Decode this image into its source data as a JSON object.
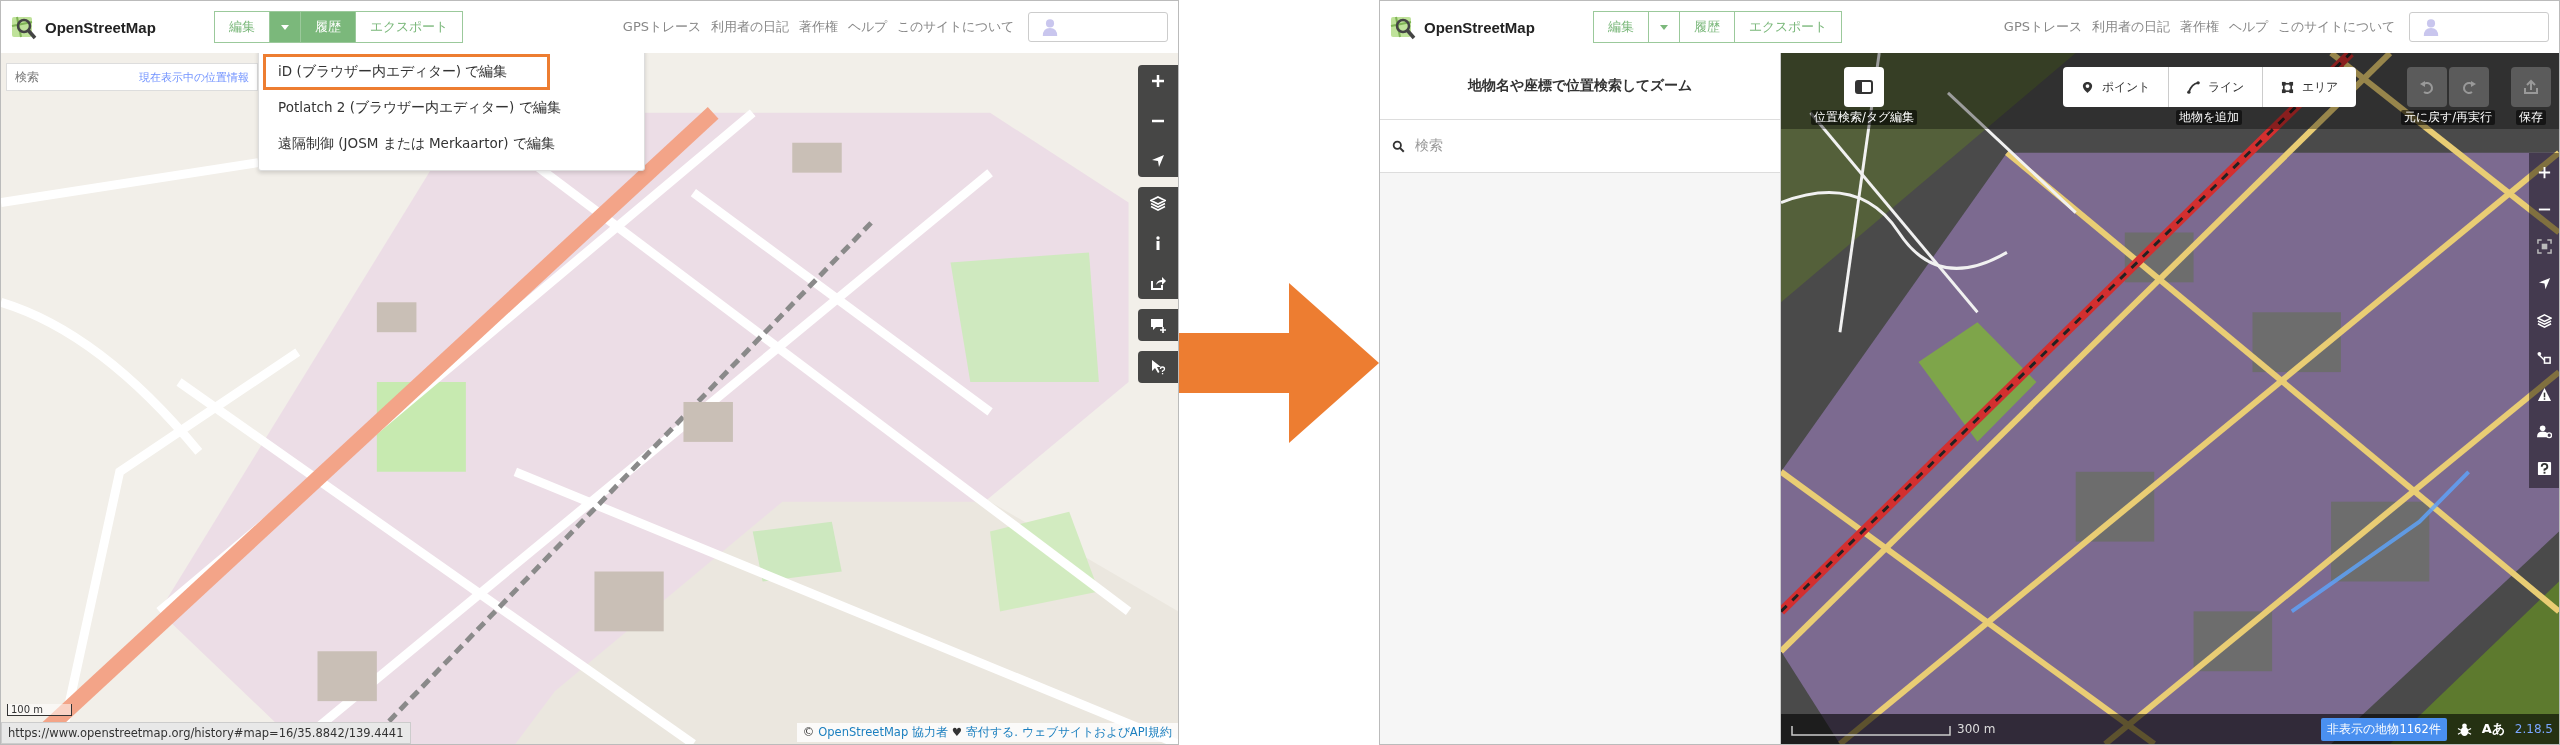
{
  "left": {
    "header": {
      "logo": "OpenStreetMap",
      "edit_buttons": [
        {
          "kind": "text",
          "label": "編集",
          "selected": false
        },
        {
          "kind": "caret",
          "selected": true
        },
        {
          "kind": "text",
          "label": "履歴",
          "selected": true
        },
        {
          "kind": "text",
          "label": "エクスポート",
          "selected": false
        }
      ],
      "nav_links": [
        "GPSトレース",
        "利用者の日記",
        "著作権",
        "ヘルプ",
        "このサイトについて"
      ]
    },
    "search": {
      "placeholder": "検索",
      "link": "現在表示中の位置情報"
    },
    "dropdown": [
      {
        "label": "iD (ブラウザー内エディター) で編集",
        "highlighted": true
      },
      {
        "label": "Potlatch 2 (ブラウザー内エディター) で編集",
        "highlighted": false
      },
      {
        "label": "遠隔制御 (JOSM または Merkaartor) で編集",
        "highlighted": false
      }
    ],
    "scale": "100 m",
    "status_url": "https://www.openstreetmap.org/history#map=16/35.8842/139.4441",
    "attribution": [
      {
        "kind": "text",
        "text": "©"
      },
      {
        "kind": "link",
        "text": "OpenStreetMap 協力者"
      },
      {
        "kind": "text",
        "text": "♥"
      },
      {
        "kind": "link",
        "text": "寄付する."
      },
      {
        "kind": "link",
        "text": "ウェブサイトおよびAPI規約"
      }
    ]
  },
  "right": {
    "header": {
      "logo": "OpenStreetMap",
      "edit_buttons": [
        {
          "kind": "text",
          "label": "編集",
          "selected": false
        },
        {
          "kind": "caret",
          "selected": false
        },
        {
          "kind": "text",
          "label": "履歴",
          "selected": false
        },
        {
          "kind": "text",
          "label": "エクスポート",
          "selected": false
        }
      ],
      "nav_links": [
        "GPSトレース",
        "利用者の日記",
        "著作権",
        "ヘルプ",
        "このサイトについて"
      ]
    },
    "sidebar": {
      "title": "地物名や座標で位置検索してズーム",
      "search_placeholder": "検索"
    },
    "toolbar": {
      "sidebar_label": "位置検索/タグ編集",
      "add_buttons": [
        "ポイント",
        "ライン",
        "エリア"
      ],
      "add_label": "地物を追加",
      "undo_label": "元に戻す/再実行",
      "save_label": "保存"
    },
    "footer": {
      "scale": "300 m",
      "hidden_features": "非表示の地物1162件",
      "language": "Aあ",
      "version": "2.18.5"
    }
  }
}
